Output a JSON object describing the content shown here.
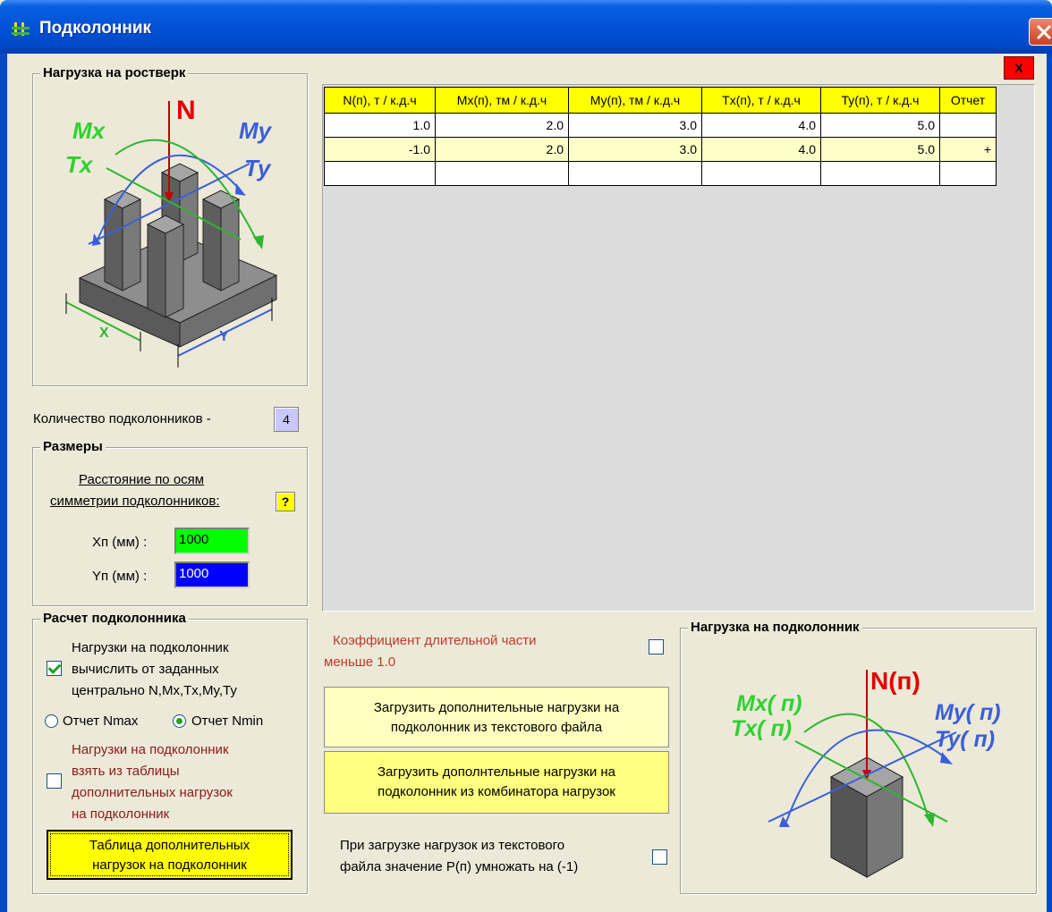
{
  "window": {
    "title": "Подколонник"
  },
  "colors": {
    "titlebar": "#0054e3",
    "x_field": "#00ff00",
    "y_field": "#0000ff",
    "table_header": "#ffff00",
    "alt_row": "#ffffc8",
    "help_button": "#ffff00",
    "count_button": "#c8c8ff",
    "close_red": "#ff0000"
  },
  "inner_close": {
    "label": "X"
  },
  "rostverk_group": {
    "title": "Нагрузка на ростверк",
    "diagram_labels": {
      "n": "N",
      "mx": "Mx",
      "my": "My",
      "tx": "Tx",
      "ty": "Ty",
      "x": "X",
      "y": "Y"
    }
  },
  "count": {
    "label": "Количество подколонников -",
    "value": "4"
  },
  "dimensions": {
    "title": "Размеры",
    "note_line1": "Расстояние по осям",
    "note_line2": "симметрии подколонников:",
    "help_label": "?",
    "x_label": "Xп (мм) :",
    "x_value": "1000",
    "y_label": "Yп (мм) :",
    "y_value": "1000"
  },
  "calc": {
    "title": "Расчет подколонника",
    "option1_line1": "Нагрузки на подколонник",
    "option1_line2": "вычислить от заданных",
    "option1_line3": "центрально N,Mx,Tx,My,Ty",
    "option1_checked": true,
    "radio_nmax": "Отчет Nmax",
    "radio_nmin": "Отчет Nmin",
    "selected_report": "Nmin",
    "option2_line1": "Нагрузки на подколонник",
    "option2_line2": "взять из таблицы",
    "option2_line3": "дополнительных нагрузок",
    "option2_line4": "на подколонник",
    "option2_checked": false,
    "table_button_line1": "Таблица дополнительных",
    "table_button_line2": "нагрузок на подколонник"
  },
  "loads_table": {
    "columns": [
      "N(п), т / к.д.ч",
      "Mx(п), тм / к.д.ч",
      "My(п), тм / к.д.ч",
      "Tx(п), т / к.д.ч",
      "Ty(п), т / к.д.ч",
      "Отчет"
    ],
    "rows": [
      [
        "1.0",
        "2.0",
        "3.0",
        "4.0",
        "5.0",
        ""
      ],
      [
        "-1.0",
        "2.0",
        "3.0",
        "4.0",
        "5.0",
        "+"
      ],
      [
        "",
        "",
        "",
        "",
        "",
        ""
      ]
    ]
  },
  "coef": {
    "line1": "Коэффициент длительной части",
    "line2": "меньше 1.0",
    "checked": false
  },
  "buttons": {
    "load_text_line1": "Загрузить дополнительные нагрузки на",
    "load_text_line2": "подколонник из текстового файла",
    "load_comb_line1": "Загрузить дополнтельные нагрузки на",
    "load_comb_line2": "подколонник из комбинатора нагрузок"
  },
  "multiply": {
    "line1": "При загрузке нагрузок из текстового",
    "line2": "файла значение Р(п) умножать на (-1)",
    "checked": false
  },
  "podkolonnik_group": {
    "title": "Нагрузка на подколонник",
    "diagram_labels": {
      "n": "N(п)",
      "mx": "Mx( п)",
      "my": "My( п)",
      "tx": "Tx( п)",
      "ty": "Ty( п)"
    }
  }
}
